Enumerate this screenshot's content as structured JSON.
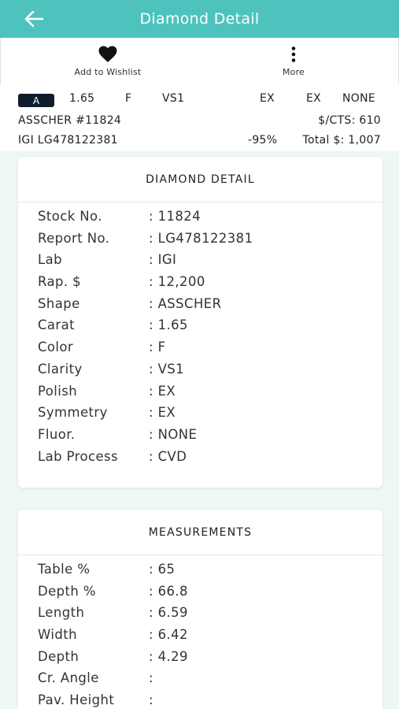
{
  "appbar": {
    "title": "Diamond Detail"
  },
  "actions": {
    "wishlist_label": "Add to Wishlist",
    "more_label": "More"
  },
  "summary": {
    "grade": "A",
    "carat": "1.65",
    "color": "F",
    "clarity": "VS1",
    "polish": "EX",
    "symmetry": "EX",
    "fluor": "NONE",
    "shape_id": "ASSCHER  #11824",
    "price_per_ct": "$/CTS: 610",
    "lab_report": "IGI   LG478122381",
    "discount": "-95%",
    "total": "Total $: 1,007"
  },
  "detail": {
    "title": "DIAMOND DETAIL",
    "rows": [
      {
        "label": "Stock No.",
        "value": "11824"
      },
      {
        "label": "Report No.",
        "value": "LG478122381"
      },
      {
        "label": "Lab",
        "value": "IGI"
      },
      {
        "label": "Rap. $",
        "value": "12,200"
      },
      {
        "label": "Shape",
        "value": "ASSCHER"
      },
      {
        "label": "Carat",
        "value": "1.65"
      },
      {
        "label": "Color",
        "value": "F"
      },
      {
        "label": "Clarity",
        "value": "VS1"
      },
      {
        "label": "Polish",
        "value": "EX"
      },
      {
        "label": "Symmetry",
        "value": "EX"
      },
      {
        "label": "Fluor.",
        "value": "NONE"
      },
      {
        "label": "Lab Process",
        "value": "CVD"
      }
    ]
  },
  "measurements": {
    "title": "MEASUREMENTS",
    "rows": [
      {
        "label": "Table %",
        "value": "65"
      },
      {
        "label": "Depth %",
        "value": "66.8"
      },
      {
        "label": "Length",
        "value": "6.59"
      },
      {
        "label": "Width",
        "value": "6.42"
      },
      {
        "label": "Depth",
        "value": "4.29"
      },
      {
        "label": "Cr. Angle",
        "value": ""
      },
      {
        "label": "Pav. Height",
        "value": ""
      }
    ]
  }
}
